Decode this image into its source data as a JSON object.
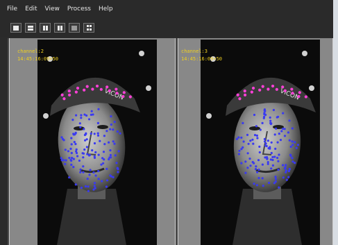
{
  "menu": [
    "File",
    "Edit",
    "View",
    "Process",
    "Help"
  ],
  "toolbar": {
    "icons": [
      "single-view-icon",
      "two-row-icon",
      "two-column-icon",
      "three-view-icon",
      "grid-view-icon",
      "quad-view-icon"
    ]
  },
  "viewports": [
    {
      "channel_label": "channel:2",
      "timecode": "14:45:16:09+50",
      "cap_text": "VICON"
    },
    {
      "channel_label": "channel:3",
      "timecode": "14:45:16:09+50",
      "cap_text": "VICON"
    }
  ],
  "colors": {
    "marker": "#3a3af0",
    "cap_marker": "#ff40d8",
    "label": "#f0d020"
  }
}
